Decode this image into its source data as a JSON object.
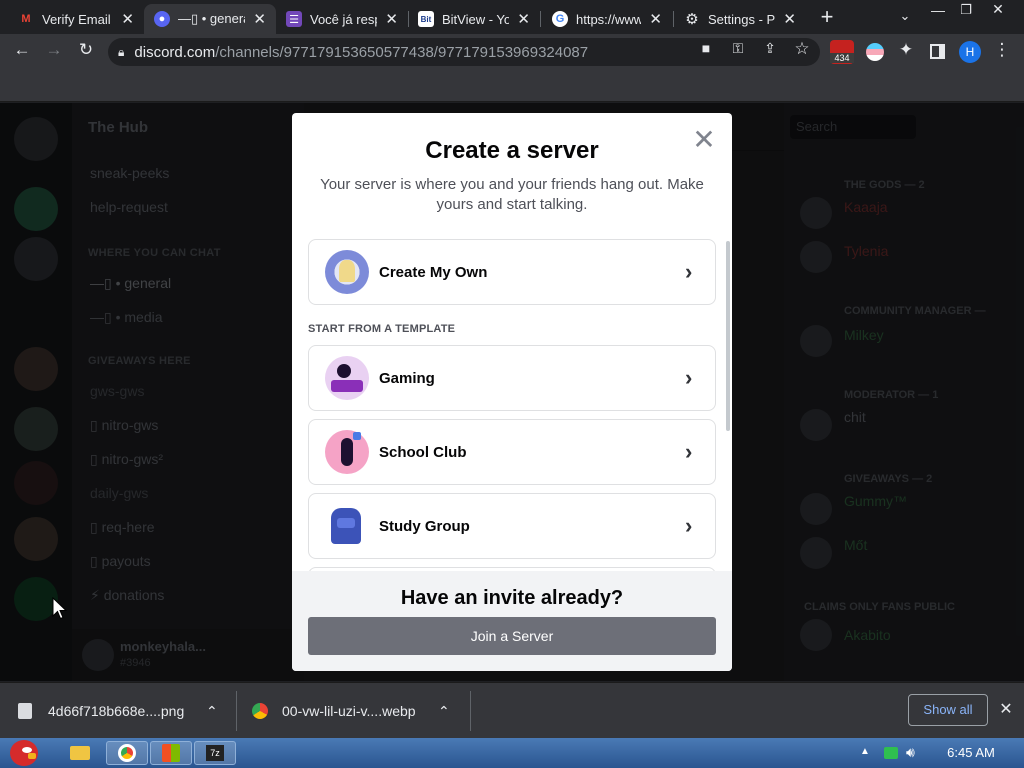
{
  "browser": {
    "tabs": [
      {
        "title": "Verify Email",
        "favicon": "gmail-icon",
        "active": false
      },
      {
        "title": "—▯ • genera",
        "favicon": "discord-icon",
        "active": true
      },
      {
        "title": "Você já resp",
        "favicon": "forms-icon",
        "active": false
      },
      {
        "title": "BitView - Yo",
        "favicon": "bitview-icon",
        "active": false
      },
      {
        "title": "https://www",
        "favicon": "google-icon",
        "active": false
      },
      {
        "title": "Settings - P",
        "favicon": "gear-icon",
        "active": false
      }
    ],
    "url_host": "discord.com",
    "url_path": "/channels/977179153650577438/977179153969324087",
    "extension_badge": "434",
    "profile_initial": "H"
  },
  "discord_bg": {
    "server_name": "The Hub",
    "categories": [
      {
        "label": "WHERE YOU CAN CHAT"
      },
      {
        "label": "GIVEAWAYS HERE"
      }
    ],
    "channels": [
      "sneak-peeks",
      "help-request",
      "—▯ • general",
      "—▯ • media",
      "gws-gws",
      "▯ nitro-gws",
      "▯ nitro-gws²",
      "daily-gws",
      "▯ req-here",
      "▯ payouts",
      "⚡ donations"
    ],
    "user": {
      "name": "monkeyhala...",
      "tag": "#3946"
    },
    "search_placeholder": "Search",
    "member_categories": [
      "THE GODS — 2",
      "COMMUNITY MANAGER —",
      "MODERATOR — 1",
      "GIVEAWAYS — 2",
      "CLAIMS ONLY FANS PUBLIC"
    ],
    "members": [
      "Kaaaja",
      "Tylenia",
      "Milkey",
      "chit",
      "Gummy™",
      "Mőt",
      "Akabito"
    ]
  },
  "modal": {
    "title": "Create a server",
    "subtitle": "Your server is where you and your friends hang out. Make yours and start talking.",
    "create_own_label": "Create My Own",
    "template_heading": "START FROM A TEMPLATE",
    "templates": [
      {
        "label": "Gaming"
      },
      {
        "label": "School Club"
      },
      {
        "label": "Study Group"
      }
    ],
    "invite_heading": "Have an invite already?",
    "join_button": "Join a Server"
  },
  "downloads": {
    "items": [
      {
        "name": "4d66f718b668e....png"
      },
      {
        "name": "00-vw-lil-uzi-v....webp"
      }
    ],
    "show_all": "Show all"
  },
  "taskbar": {
    "clock": "6:45 AM"
  },
  "colors": {
    "discord_blurple": "#5865f2",
    "modal_bg": "#ffffff",
    "join_button_bg": "#6d6f78",
    "chrome_dark": "#35363a"
  }
}
